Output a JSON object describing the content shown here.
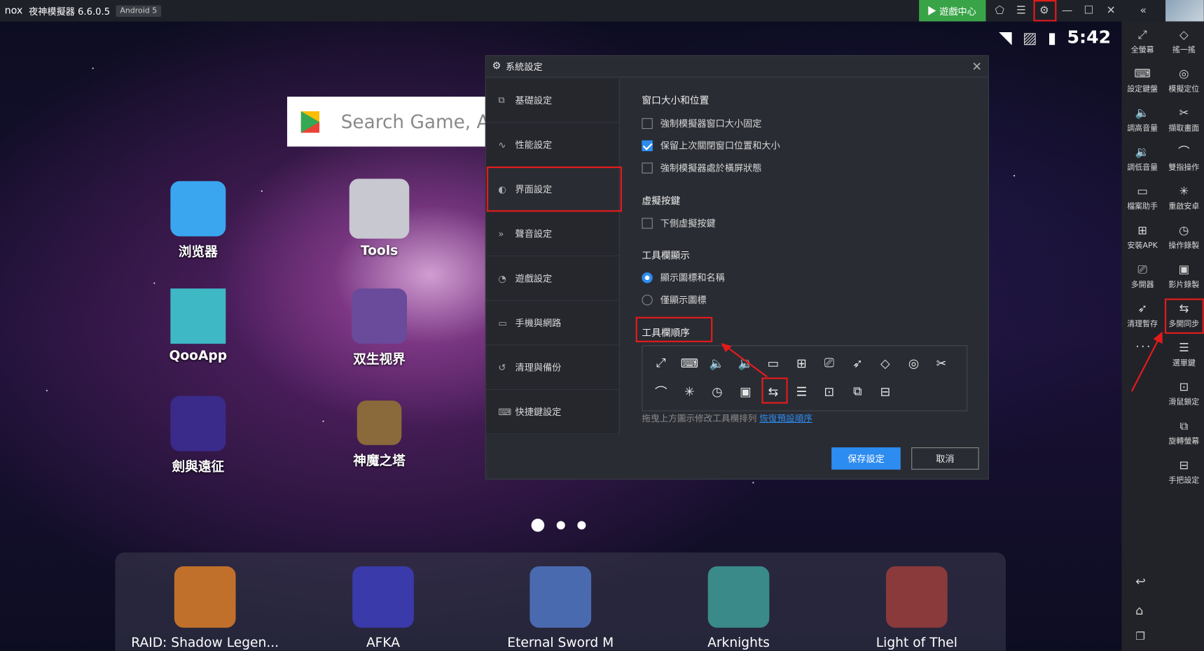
{
  "titlebar": {
    "logo": "nox",
    "app_title": "夜神模擬器 6.6.0.5",
    "android_badge": "Android 5",
    "game_center": "遊戲中心",
    "buttons": [
      "shirt-icon",
      "menu-icon",
      "gear-icon",
      "minimize-icon",
      "maximize-icon",
      "close-icon",
      "collapse-icon"
    ]
  },
  "status": {
    "time": "5:42"
  },
  "search": {
    "placeholder": "Search Game, A"
  },
  "apps": [
    {
      "label": "浏览器",
      "icon": "browser-icon",
      "color": "#3aa6f0"
    },
    {
      "label": "Tools",
      "icon": "tools-folder-icon",
      "color": "#c8c8d0"
    },
    {
      "label": "QooApp",
      "icon": "qooapp-icon",
      "color": "#3fb8c6"
    },
    {
      "label": "双生视界",
      "icon": "game-icon",
      "color": "#6a4a9a"
    },
    {
      "label": "劍與遠征",
      "icon": "game-icon",
      "color": "#3a2a8a"
    },
    {
      "label": "神魔之塔",
      "icon": "game-icon",
      "color": "#8a6a3a"
    }
  ],
  "dock": [
    {
      "label": "RAID: Shadow Legen...",
      "color": "#c0702a"
    },
    {
      "label": "AFKA",
      "color": "#3a3aaa"
    },
    {
      "label": "Eternal Sword M",
      "color": "#4a6ab0"
    },
    {
      "label": "Arknights",
      "color": "#3a8a8a"
    },
    {
      "label": "Light of Thel",
      "color": "#8a3a3a"
    }
  ],
  "dialog": {
    "title": "系統設定",
    "nav": [
      "基礎設定",
      "性能設定",
      "界面設定",
      "聲音設定",
      "遊戲設定",
      "手機與網路",
      "清理與備份",
      "快捷鍵設定"
    ],
    "sections": {
      "window": "窗口大小和位置",
      "window_opts": [
        "強制模擬器窗口大小固定",
        "保留上次關閉窗口位置和大小",
        "強制模擬器處於橫屏狀態"
      ],
      "window_checked": [
        false,
        true,
        false
      ],
      "virtual_keys": "虛擬按鍵",
      "virtual_opts": [
        "下側虛擬按鍵"
      ],
      "toolbar_display": "工具欄顯示",
      "toolbar_display_opts": [
        "顯示圖標和名稱",
        "僅顯示圖標"
      ],
      "toolbar_order": "工具欄順序"
    },
    "hint": "拖曳上方圖示修改工具欄排列",
    "restore_link": "恢復預設順序",
    "save": "保存設定",
    "cancel": "取消"
  },
  "right_toolbar": [
    {
      "label": "全螢幕",
      "icon": "fullscreen-icon"
    },
    {
      "label": "搖一搖",
      "icon": "shake-icon"
    },
    {
      "label": "設定鍵盤",
      "icon": "keyboard-icon"
    },
    {
      "label": "模擬定位",
      "icon": "location-icon"
    },
    {
      "label": "調高音量",
      "icon": "volume-up-icon"
    },
    {
      "label": "擷取畫面",
      "icon": "scissors-icon"
    },
    {
      "label": "調低音量",
      "icon": "volume-down-icon"
    },
    {
      "label": "雙指操作",
      "icon": "touch-icon"
    },
    {
      "label": "檔案助手",
      "icon": "file-icon"
    },
    {
      "label": "重啟安卓",
      "icon": "restart-icon"
    },
    {
      "label": "安裝APK",
      "icon": "apk-icon"
    },
    {
      "label": "操作錄製",
      "icon": "record-icon"
    },
    {
      "label": "多開器",
      "icon": "multi-icon"
    },
    {
      "label": "影片錄製",
      "icon": "video-icon"
    },
    {
      "label": "清理暫存",
      "icon": "rocket-icon"
    },
    {
      "label": "多開同步",
      "icon": "sync-icon"
    },
    {
      "label": "選單鍵",
      "icon": "menu-icon"
    },
    {
      "label": "滑鼠鎖定",
      "icon": "mouse-lock-icon"
    },
    {
      "label": "旋轉螢幕",
      "icon": "rotate-icon"
    },
    {
      "label": "手把設定",
      "icon": "gamepad-icon"
    }
  ]
}
